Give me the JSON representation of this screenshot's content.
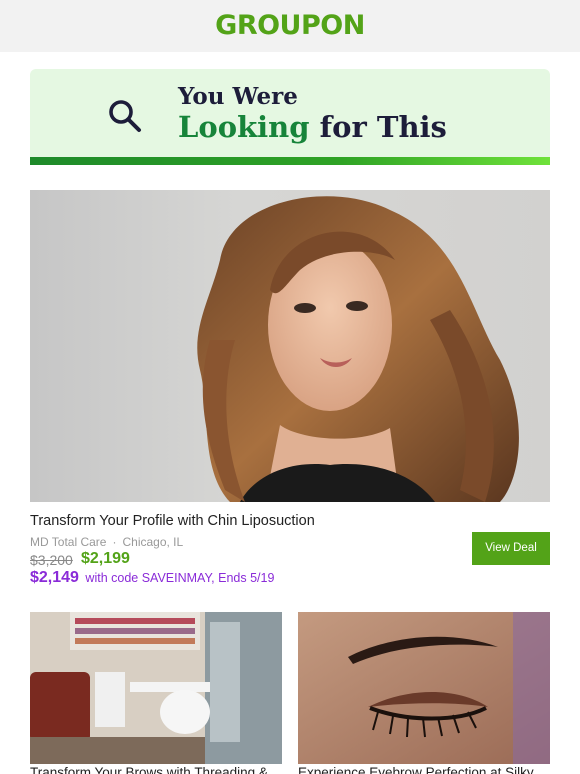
{
  "header": {
    "logo_text": "GROUPON",
    "brand_color": "#53a318"
  },
  "banner": {
    "icon": "search-icon",
    "line1": "You Were",
    "line2_highlight": "Looking",
    "line2_rest": "for This"
  },
  "featured_deal": {
    "image_alt": "woman-with-wavy-hair-photo",
    "title": "Transform Your Profile with Chin Liposuction",
    "merchant": "MD Total Care",
    "separator": "·",
    "location": "Chicago, IL",
    "original_price": "$3,200",
    "sale_price": "$2,199",
    "promo_price": "$2,149",
    "promo_text": "with code SAVEINMAY, Ends 5/19",
    "cta_label": "View Deal"
  },
  "more_deals": [
    {
      "image_alt": "salon-interior-photo",
      "title": "Transform Your Brows with Threading &"
    },
    {
      "image_alt": "eye-closeup-photo",
      "title": "Experience Eyebrow Perfection at Silky"
    }
  ]
}
